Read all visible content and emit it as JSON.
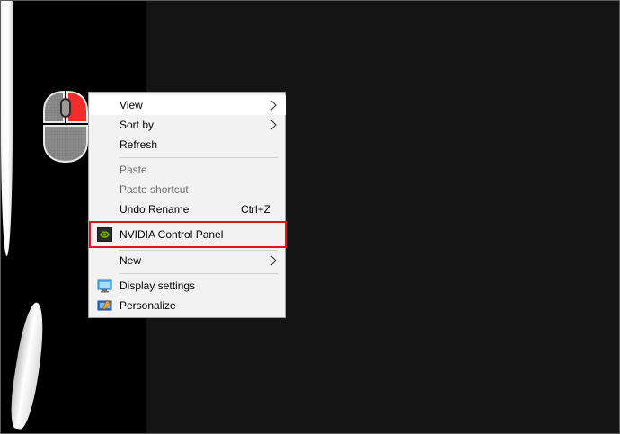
{
  "context_menu": {
    "items": [
      {
        "label": "View",
        "submenu": true
      },
      {
        "label": "Sort by",
        "submenu": true
      },
      {
        "label": "Refresh"
      },
      {
        "label": "Paste",
        "disabled": true
      },
      {
        "label": "Paste shortcut",
        "disabled": true
      },
      {
        "label": "Undo Rename",
        "shortcut": "Ctrl+Z"
      },
      {
        "label": "NVIDIA Control Panel",
        "icon": "nvidia-icon"
      },
      {
        "label": "New",
        "submenu": true
      },
      {
        "label": "Display settings",
        "icon": "display-settings-icon"
      },
      {
        "label": "Personalize",
        "icon": "personalize-icon"
      }
    ]
  },
  "annotations": {
    "mouse_icon": "right-click-mouse-icon",
    "highlight_color": "#e0141e",
    "mouse_button_color": "#ff3b3b"
  }
}
